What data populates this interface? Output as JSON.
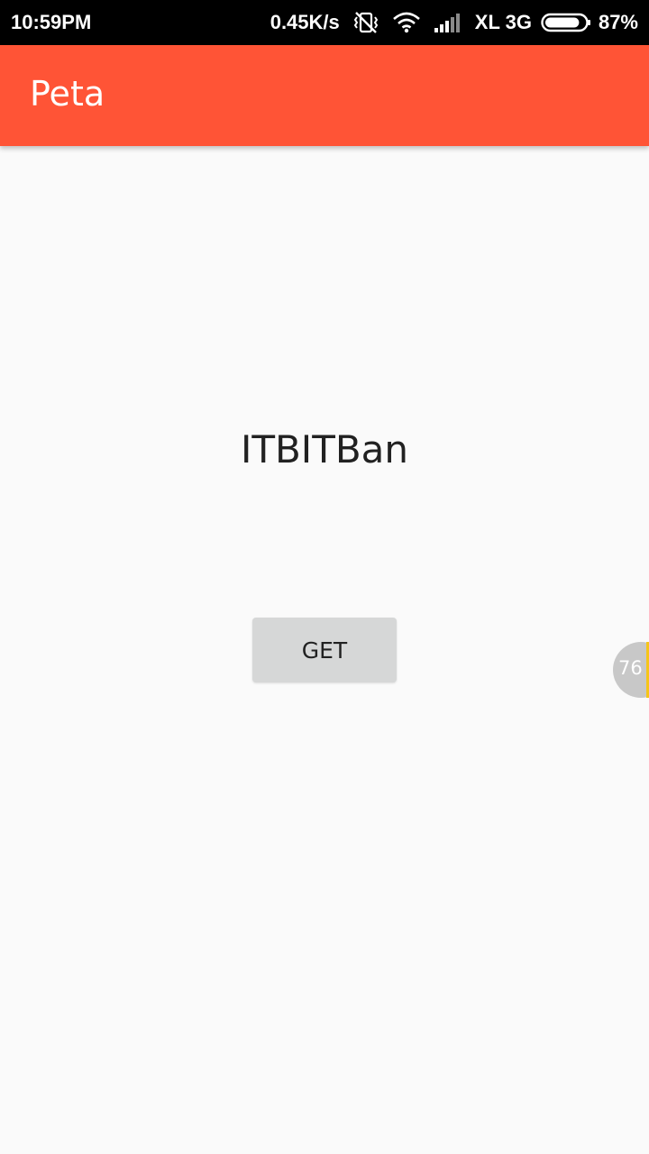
{
  "status_bar": {
    "time": "10:59PM",
    "net_speed": "0.45K/s",
    "carrier": "XL 3G",
    "battery_percent": "87%",
    "battery_level": 0.87,
    "icons": [
      "vibrate-off-icon",
      "wifi-icon",
      "cell-signal-icon",
      "battery-icon"
    ]
  },
  "app_bar": {
    "title": "Peta",
    "color": "#ff5436"
  },
  "main": {
    "text": "ITBITBan",
    "button_label": "GET"
  },
  "floating_bubble": {
    "value": "76",
    "accent": "#f5c518"
  }
}
